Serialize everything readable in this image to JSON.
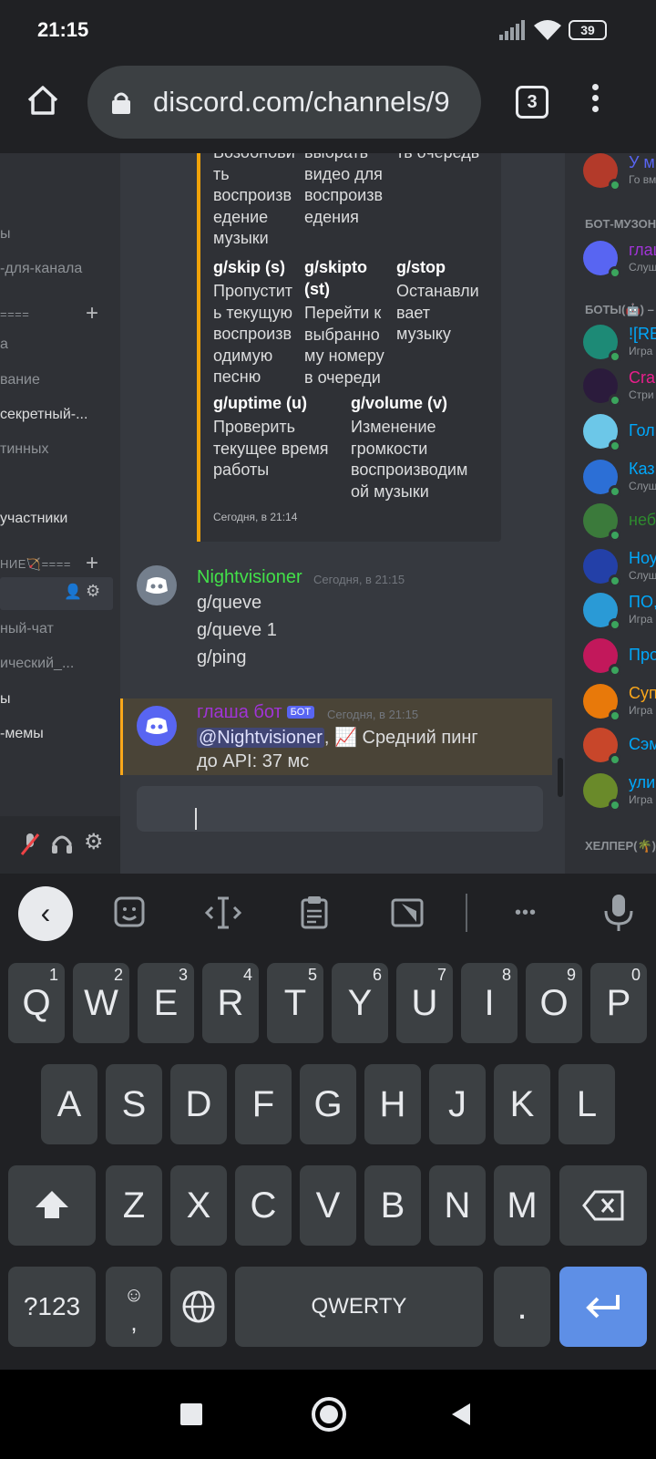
{
  "status_bar": {
    "time": "21:15",
    "battery": "39"
  },
  "browser": {
    "url": "discord.com/channels/9",
    "tab_count": "3"
  },
  "channels": {
    "items": [
      {
        "label": "ы",
        "bright": false
      },
      {
        "label": "-для-канала",
        "bright": false
      },
      {
        "label": "====",
        "bright": false,
        "category": true
      },
      {
        "label": "а",
        "bright": false
      },
      {
        "label": "вание",
        "bright": false
      },
      {
        "label": "секретный-...",
        "bright": true
      },
      {
        "label": "тинных",
        "bright": false
      },
      {
        "label": "участники",
        "bright": true
      },
      {
        "label": "НИЕ🏹====",
        "bright": false,
        "category": true
      },
      {
        "label": "ный-чат",
        "bright": false
      },
      {
        "label": "ический_...",
        "bright": false
      },
      {
        "label": "ы",
        "bright": true
      },
      {
        "label": "-мемы",
        "bright": true
      }
    ]
  },
  "embed": {
    "top_cells": [
      {
        "text": "Возобнови\nть\nвоспроизв\nедение\nмузыки"
      },
      {
        "text": "выбрать\nвидео для\nвоспроизв\nедения"
      },
      {
        "text": "ть очередь"
      }
    ],
    "commands": [
      {
        "name": "g/skip (s)",
        "desc": "Пропустит\nь текущую\nвоспроизв\nодимую\nпесню"
      },
      {
        "name": "g/skipto\n(st)",
        "desc": "Перейти к\nвыбранно\nму номеру\nв очереди"
      },
      {
        "name": "g/stop",
        "desc": "Останавли\nвает\nмузыку"
      },
      {
        "name": "g/uptime (u)",
        "desc": "Проверить\nтекущее время\nработы"
      },
      {
        "name": "g/volume (v)",
        "desc": "Изменение\nгромкости\nвоспроизводим\nой музыки"
      }
    ],
    "footer": "Сегодня, в 21:14"
  },
  "messages": [
    {
      "author": "Nightvisioner",
      "author_color": "#43e04a",
      "timestamp": "Сегодня, в 21:15",
      "lines": [
        "g/queve",
        "g/queve 1",
        "g/ping"
      ]
    },
    {
      "author": "глаша бот",
      "author_color": "#a034d6",
      "badge": "БОТ",
      "timestamp": "Сегодня, в 21:15",
      "mention": "@Nightvisioner",
      "text_after_mention": ", 📈 Средний пинг",
      "line2": "до API: 37 мс"
    }
  ],
  "members": {
    "categories": [
      "БОТ-МУЗОН",
      "БОТЫ(🤖) –",
      "ХЕЛПЕР(🌴)"
    ],
    "items": [
      {
        "name": "У м",
        "sub": "Го вм",
        "color": "#5865f2",
        "avatar": "#b33a2a"
      },
      {
        "name": "глаш",
        "sub": "Слуш",
        "color": "#a034d6",
        "avatar": "#5865f2"
      },
      {
        "name": "![RE",
        "sub": "Игра",
        "color": "#00a8fc",
        "avatar": "#1d8a76"
      },
      {
        "name": "Cra",
        "sub": "Стри",
        "color": "#e91e8c",
        "avatar": "#2b1b3c"
      },
      {
        "name": "Гол",
        "sub": "",
        "color": "#00a8fc",
        "avatar": "#6cc7e8"
      },
      {
        "name": "Каз",
        "sub": "Слуш",
        "color": "#00a8fc",
        "avatar": "#2c6fd6"
      },
      {
        "name": "неб",
        "sub": "",
        "color": "#2e8b2e",
        "avatar": "#3b7a3b"
      },
      {
        "name": "Ноу",
        "sub": "Слуш",
        "color": "#00a8fc",
        "avatar": "#2340a8"
      },
      {
        "name": "ПО,",
        "sub": "Игра",
        "color": "#00a8fc",
        "avatar": "#2a9ad6"
      },
      {
        "name": "Про",
        "sub": "",
        "color": "#00a8fc",
        "avatar": "#c2185b"
      },
      {
        "name": "Суп",
        "sub": "Игра",
        "color": "#faa61a",
        "avatar": "#e8790a"
      },
      {
        "name": "Сэм",
        "sub": "",
        "color": "#00a8fc",
        "avatar": "#c8462a"
      },
      {
        "name": "ули",
        "sub": "Игра",
        "color": "#00a8fc",
        "avatar": "#6a8a2a"
      }
    ]
  },
  "keyboard": {
    "row1": [
      {
        "k": "Q",
        "n": "1"
      },
      {
        "k": "W",
        "n": "2"
      },
      {
        "k": "E",
        "n": "3"
      },
      {
        "k": "R",
        "n": "4"
      },
      {
        "k": "T",
        "n": "5"
      },
      {
        "k": "Y",
        "n": "6"
      },
      {
        "k": "U",
        "n": "7"
      },
      {
        "k": "I",
        "n": "8"
      },
      {
        "k": "O",
        "n": "9"
      },
      {
        "k": "P",
        "n": "0"
      }
    ],
    "row2": [
      "A",
      "S",
      "D",
      "F",
      "G",
      "H",
      "J",
      "K",
      "L"
    ],
    "row3": [
      "Z",
      "X",
      "C",
      "V",
      "B",
      "N",
      "M"
    ],
    "symbols_label": "?123",
    "comma_label": ",",
    "space_label": "QWERTY",
    "period_label": ".",
    "ellipsis": "•••"
  }
}
